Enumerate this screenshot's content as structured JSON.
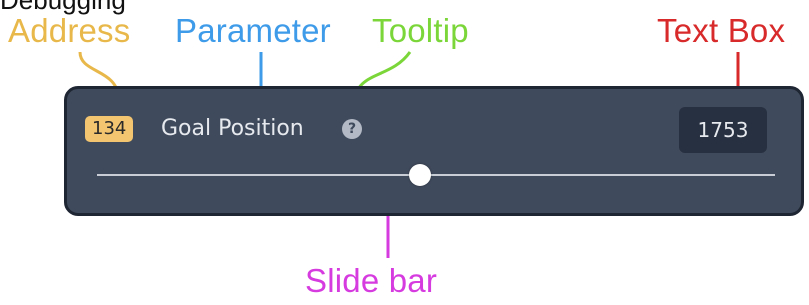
{
  "header_fragment": "Debugging",
  "labels": {
    "address": "Address",
    "parameter": "Parameter",
    "tooltip": "Tooltip",
    "text_box": "Text Box",
    "slide_bar": "Slide bar"
  },
  "widget": {
    "address": "134",
    "parameter_name": "Goal Position",
    "help_glyph": "?",
    "value": "1753",
    "slider_level": 0.477
  },
  "colors": {
    "address": "#e8b84a",
    "parameter": "#3d9be9",
    "tooltip": "#7bd63a",
    "text_box": "#d82a2a",
    "slide_bar": "#d63be0",
    "panel": "#3f4a5c",
    "badge": "#f3c570"
  },
  "icons": {
    "help": "question-circle-icon"
  }
}
